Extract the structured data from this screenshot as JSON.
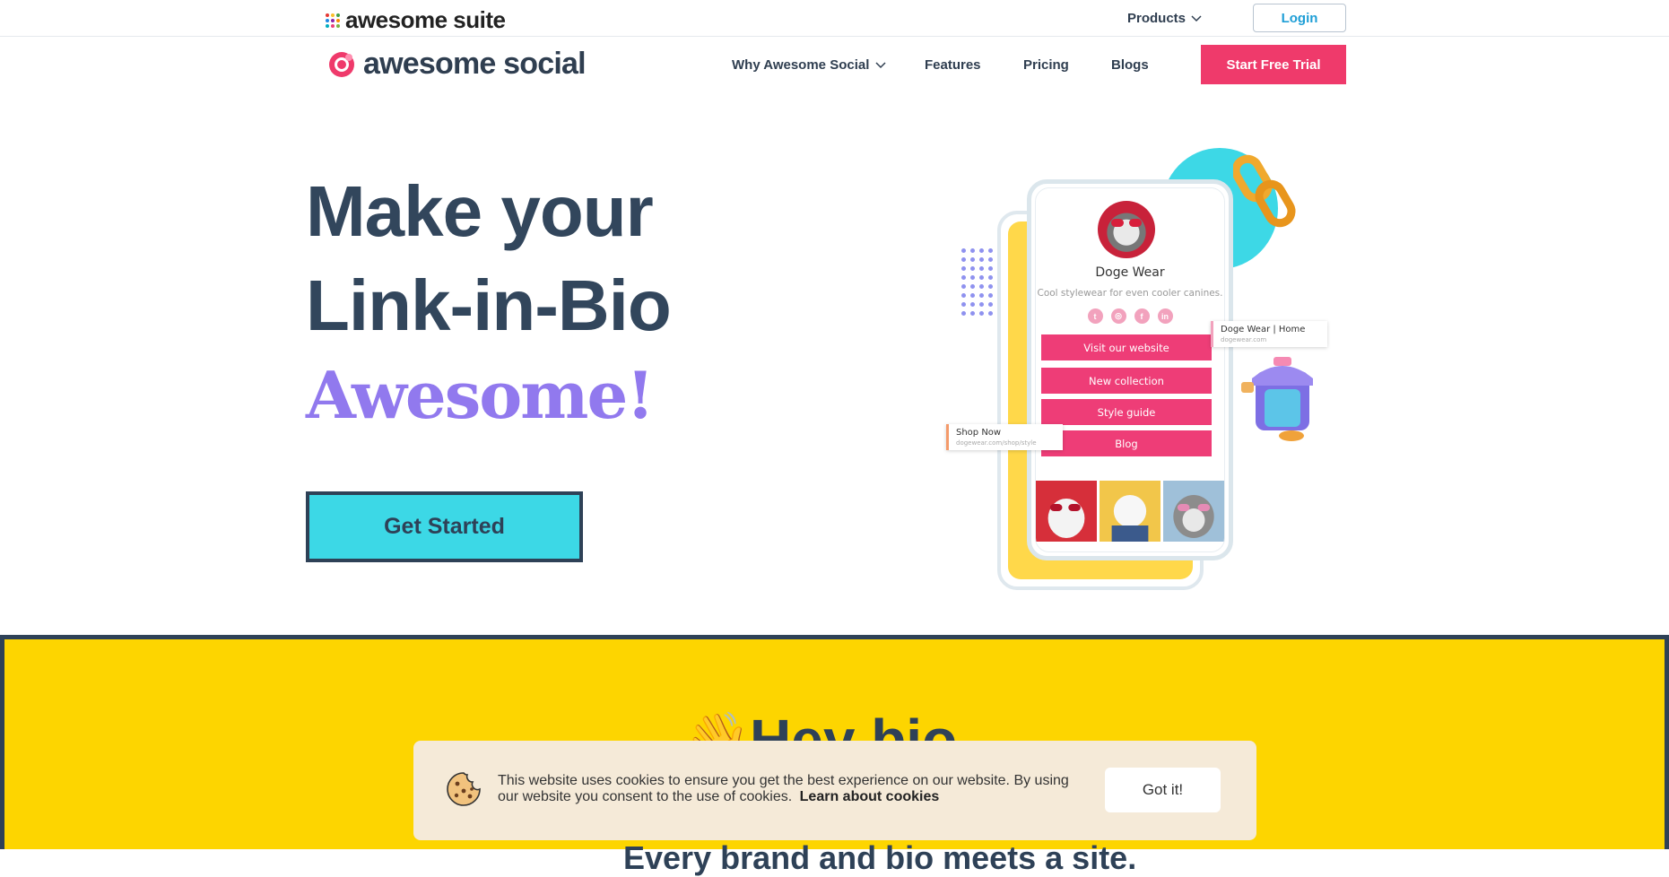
{
  "suite_bar": {
    "logo_text": "awesome suite",
    "dot_colors": [
      "#e53935",
      "#fbc02d",
      "#43a047",
      "#1e88e5",
      "#8e24aa",
      "#fb8c00",
      "#00acc1",
      "#ec407a",
      "#7cb342"
    ],
    "products_label": "Products",
    "login_label": "Login"
  },
  "main_nav": {
    "brand_name": "awesome social",
    "items": [
      {
        "label": "Why Awesome Social",
        "has_dropdown": true
      },
      {
        "label": "Features",
        "has_dropdown": false
      },
      {
        "label": "Pricing",
        "has_dropdown": false
      },
      {
        "label": "Blogs",
        "has_dropdown": false
      }
    ],
    "cta_label": "Start Free Trial"
  },
  "hero": {
    "line1": "Make your",
    "line2": "Link-in-Bio",
    "highlight": "Awesome!",
    "cta_label": "Get Started"
  },
  "phone_preview": {
    "profile_name": "Doge Wear",
    "profile_description": "Cool stylewear for even cooler canines.",
    "social_icons": [
      "twitter-icon",
      "instagram-icon",
      "facebook-icon",
      "linkedin-icon"
    ],
    "links": [
      "Visit our website",
      "New collection",
      "Style guide",
      "Blog"
    ],
    "tooltip_home_title": "Doge Wear | Home",
    "tooltip_home_url": "dogewear.com",
    "tooltip_shop_title": "Shop Now",
    "tooltip_shop_url": "dogewear.com/shop/style"
  },
  "section": {
    "heading": "Hey bio",
    "subheading": "Every brand and bio meets a site."
  },
  "cookie_banner": {
    "message": "This website uses cookies to ensure you get the best experience on our website. By using our website you consent to the use of cookies.",
    "link_label": "Learn about cookies",
    "button_label": "Got it!"
  },
  "colors": {
    "brand_pink": "#ef3a6b",
    "hero_text": "#32465c",
    "highlight_purple": "#9179ee",
    "cta_cyan": "#3cd8e6",
    "section_yellow": "#fdd500",
    "login_blue": "#1e9ed6"
  }
}
